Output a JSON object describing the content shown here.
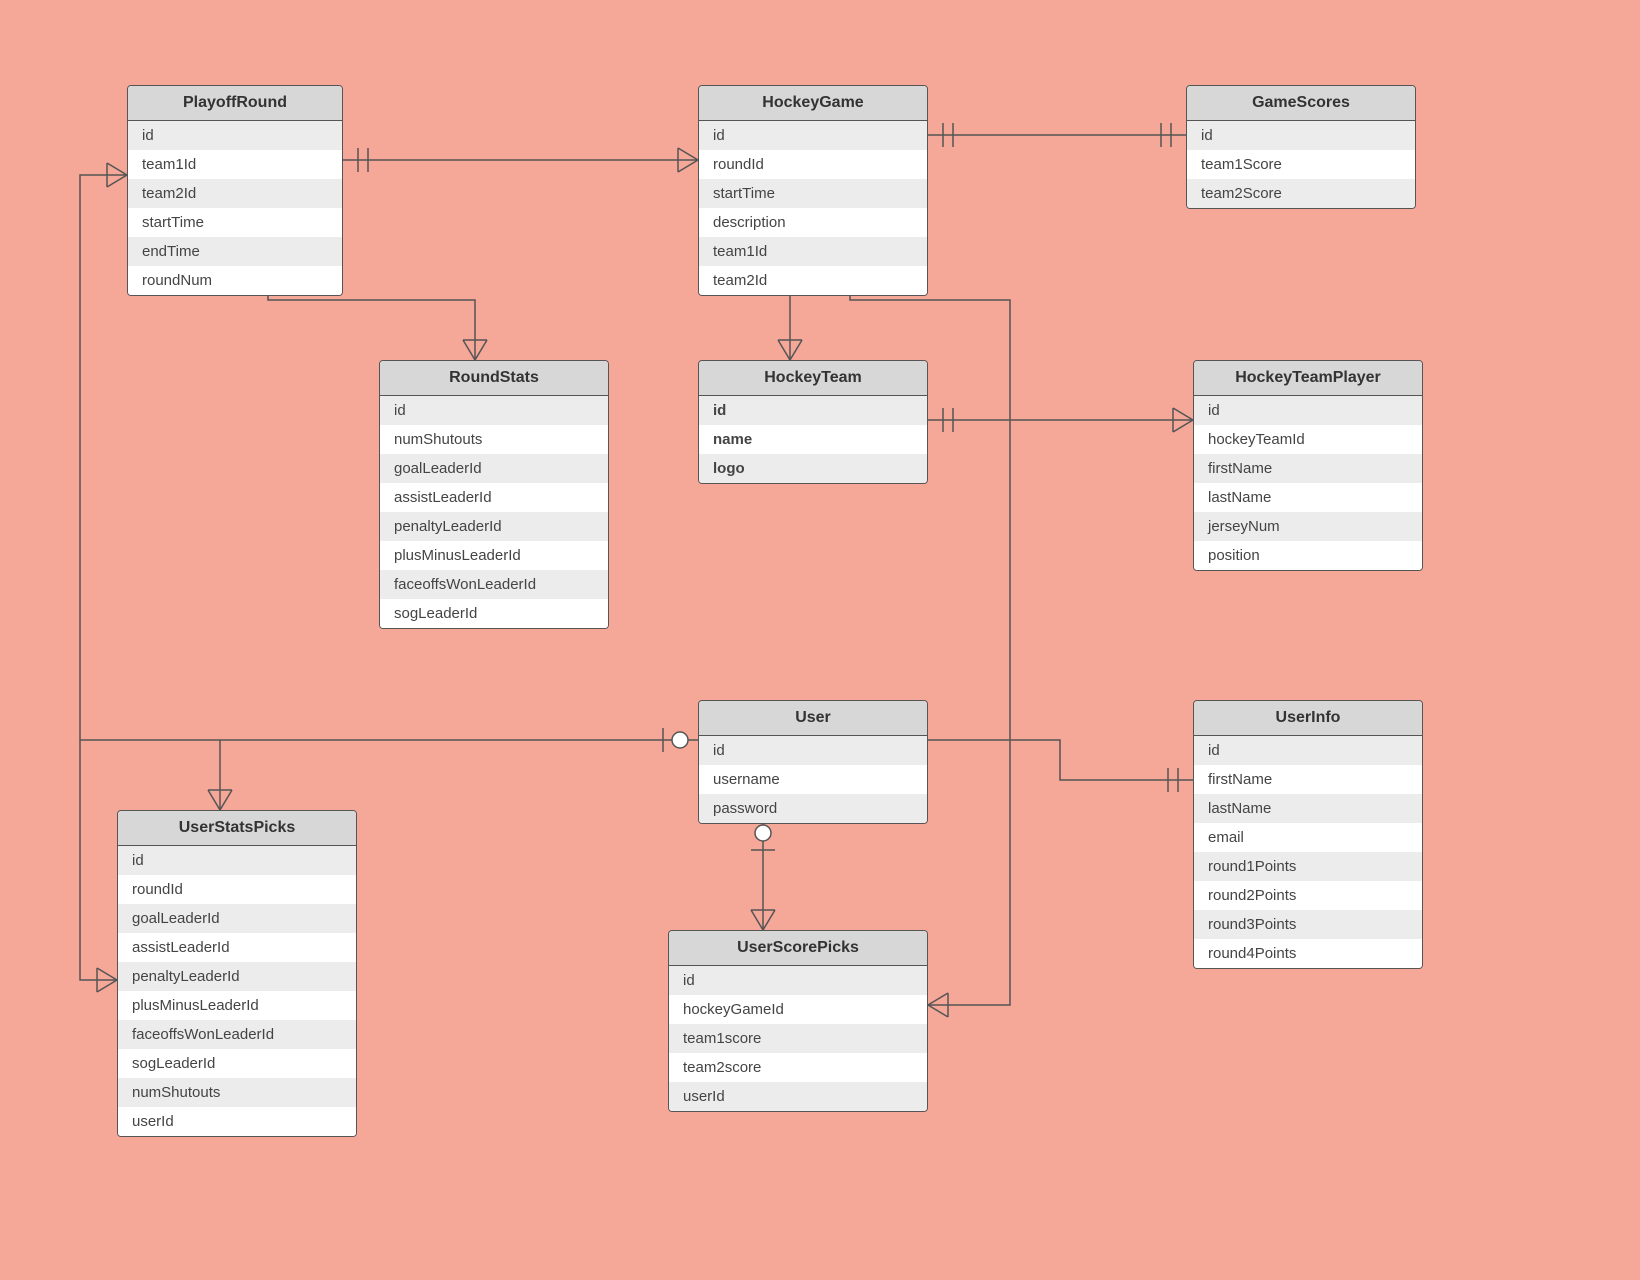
{
  "entities": {
    "playoffRound": {
      "title": "PlayoffRound",
      "fields": [
        "id",
        "team1Id",
        "team2Id",
        "startTime",
        "endTime",
        "roundNum"
      ]
    },
    "hockeyGame": {
      "title": "HockeyGame",
      "fields": [
        "id",
        "roundId",
        "startTime",
        "description",
        "team1Id",
        "team2Id"
      ]
    },
    "gameScores": {
      "title": "GameScores",
      "fields": [
        "id",
        "team1Score",
        "team2Score"
      ]
    },
    "roundStats": {
      "title": "RoundStats",
      "fields": [
        "id",
        "numShutouts",
        "goalLeaderId",
        "assistLeaderId",
        "penaltyLeaderId",
        "plusMinusLeaderId",
        "faceoffsWonLeaderId",
        "sogLeaderId"
      ]
    },
    "hockeyTeam": {
      "title": "HockeyTeam",
      "fields": [
        "id",
        "name",
        "logo"
      ],
      "bold": true
    },
    "hockeyTeamPlayer": {
      "title": "HockeyTeamPlayer",
      "fields": [
        "id",
        "hockeyTeamId",
        "firstName",
        "lastName",
        "jerseyNum",
        "position"
      ]
    },
    "user": {
      "title": "User",
      "fields": [
        "id",
        "username",
        "password"
      ]
    },
    "userInfo": {
      "title": "UserInfo",
      "fields": [
        "id",
        "firstName",
        "lastName",
        "email",
        "round1Points",
        "round2Points",
        "round3Points",
        "round4Points"
      ]
    },
    "userStatsPicks": {
      "title": "UserStatsPicks",
      "fields": [
        "id",
        "roundId",
        "goalLeaderId",
        "assistLeaderId",
        "penaltyLeaderId",
        "plusMinusLeaderId",
        "faceoffsWonLeaderId",
        "sogLeaderId",
        "numShutouts",
        "userId"
      ]
    },
    "userScorePicks": {
      "title": "UserScorePicks",
      "fields": [
        "id",
        "hockeyGameId",
        "team1score",
        "team2score",
        "userId"
      ]
    }
  }
}
